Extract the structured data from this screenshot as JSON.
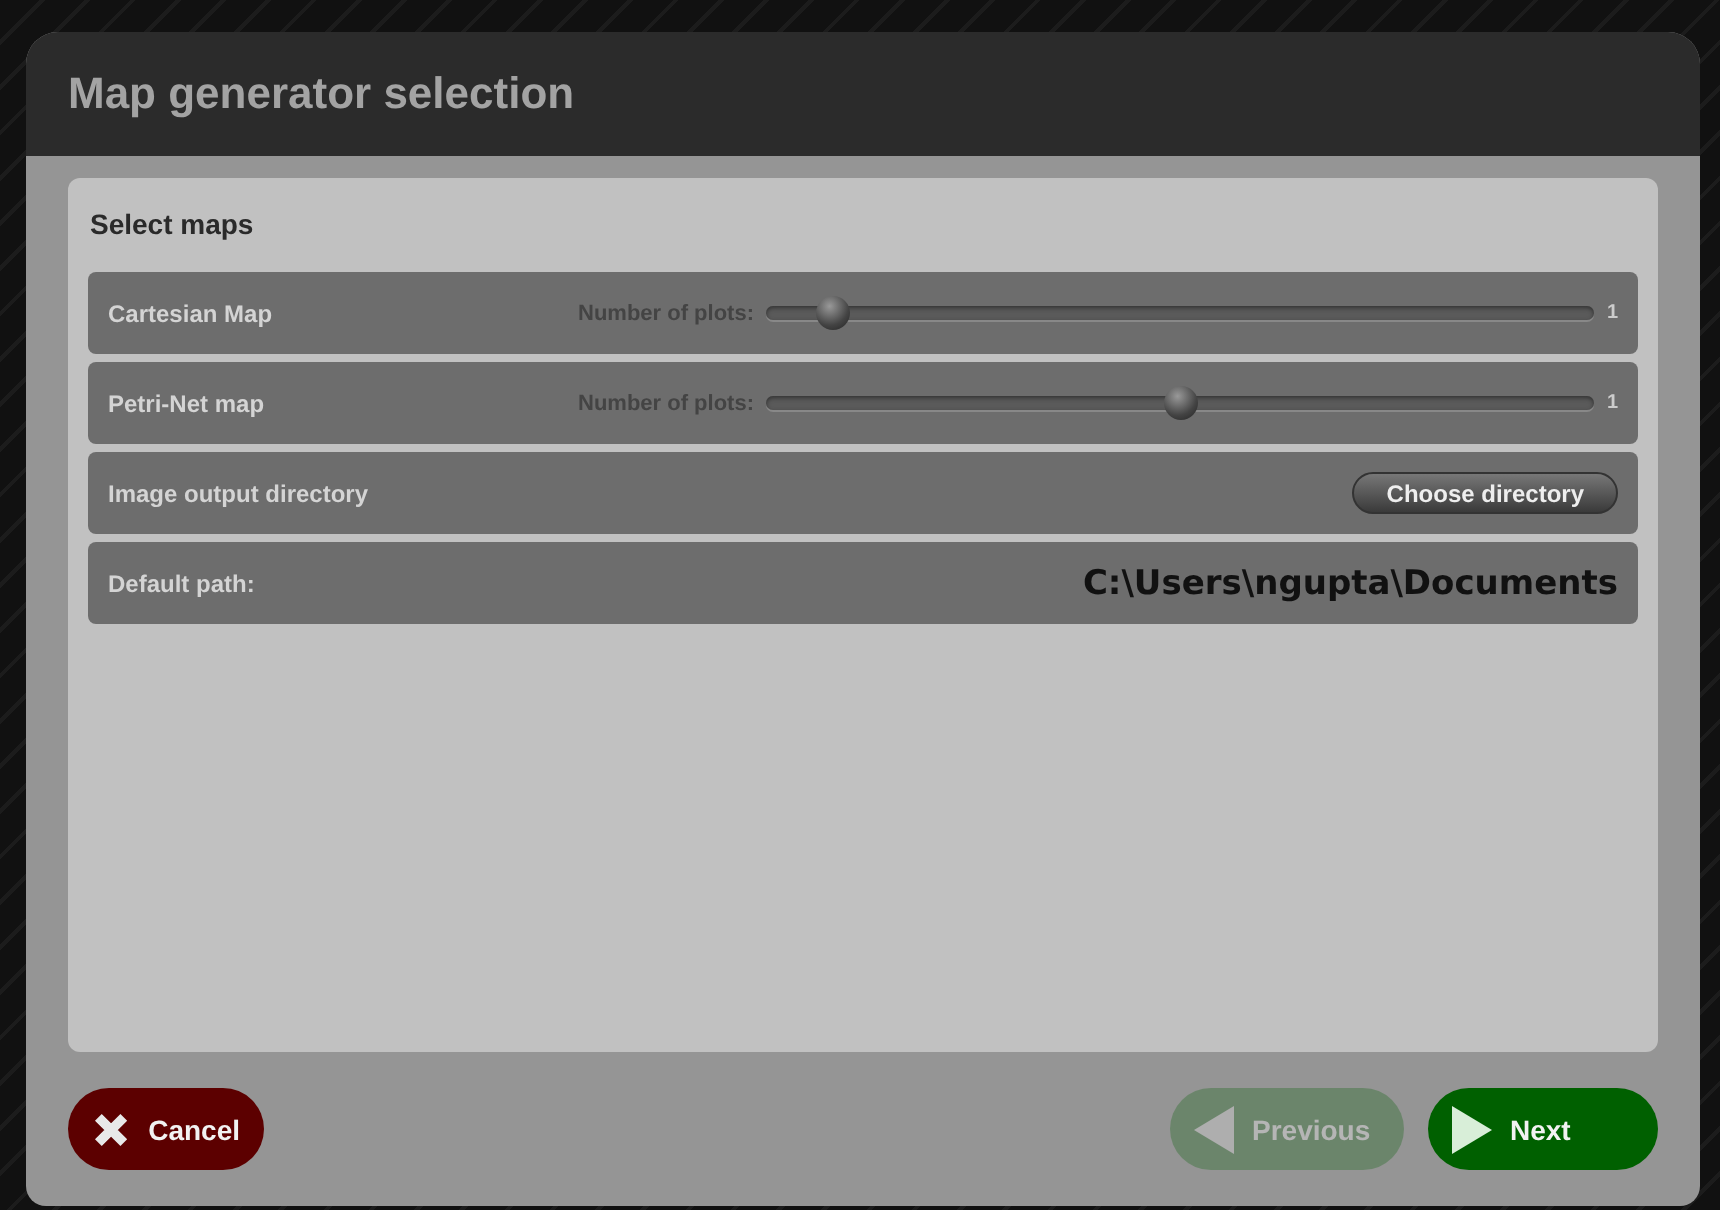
{
  "window": {
    "title": "Map generator selection"
  },
  "section": {
    "title": "Select maps"
  },
  "rows": [
    {
      "kind": "slider",
      "label": "Cartesian Map",
      "slider_label": "Number of plots:",
      "level": 0.08,
      "reading": "1"
    },
    {
      "kind": "slider",
      "label": "Petri-Net map",
      "slider_label": "Number of plots:",
      "level": 0.5,
      "reading": "1"
    },
    {
      "kind": "button",
      "label": "Image output directory",
      "button": "Choose directory"
    },
    {
      "kind": "path",
      "label": "Default path:",
      "value": "C:\\Users\\ngupta\\Documents"
    }
  ],
  "footer": {
    "cancel": {
      "label": "Cancel",
      "disabled": false
    },
    "previous": {
      "label": "Previous",
      "disabled": true
    },
    "next": {
      "label": "Next",
      "disabled": false
    }
  }
}
